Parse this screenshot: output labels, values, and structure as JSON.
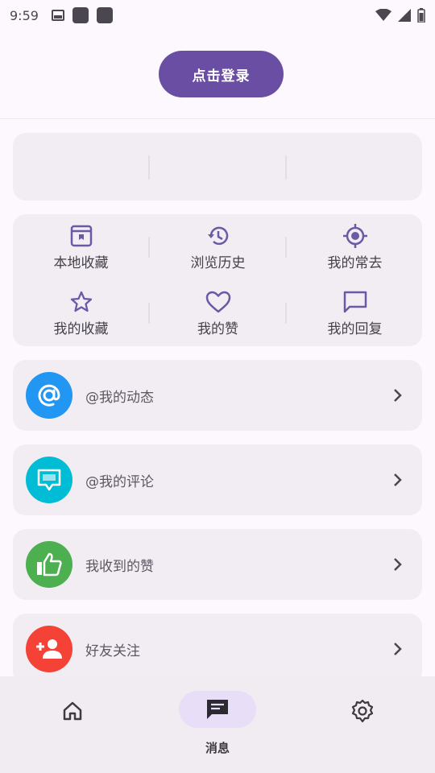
{
  "status_bar": {
    "time": "9:59",
    "icons": [
      "image-icon",
      "app-square-icon",
      "app-square-icon",
      "wifi-icon",
      "signal-icon",
      "battery-icon"
    ]
  },
  "header": {
    "login_label": "点击登录"
  },
  "quick_grid": {
    "items": [
      {
        "label": "本地收藏",
        "icon": "local-favorite-icon"
      },
      {
        "label": "浏览历史",
        "icon": "history-icon"
      },
      {
        "label": "我的常去",
        "icon": "location-target-icon"
      },
      {
        "label": "我的收藏",
        "icon": "star-icon"
      },
      {
        "label": "我的赞",
        "icon": "heart-icon"
      },
      {
        "label": "我的回复",
        "icon": "comment-icon"
      }
    ]
  },
  "list": {
    "items": [
      {
        "label": "@我的动态",
        "icon": "at-icon",
        "color": "#2196f3"
      },
      {
        "label": "@我的评论",
        "icon": "comment-bubble-icon",
        "color": "#00bcd4"
      },
      {
        "label": "我收到的赞",
        "icon": "thumb-up-icon",
        "color": "#4caf50"
      },
      {
        "label": "好友关注",
        "icon": "person-add-icon",
        "color": "#f44336"
      }
    ]
  },
  "bottom_nav": {
    "items": [
      {
        "label": "",
        "icon": "home-icon"
      },
      {
        "label": "消息",
        "icon": "message-icon",
        "active": true
      },
      {
        "label": "",
        "icon": "settings-icon"
      }
    ]
  },
  "colors": {
    "accent": "#6a4ea3",
    "icon_purple": "#6a5aa6",
    "card_bg": "#f2edf3",
    "page_bg": "#fcf8fd"
  }
}
